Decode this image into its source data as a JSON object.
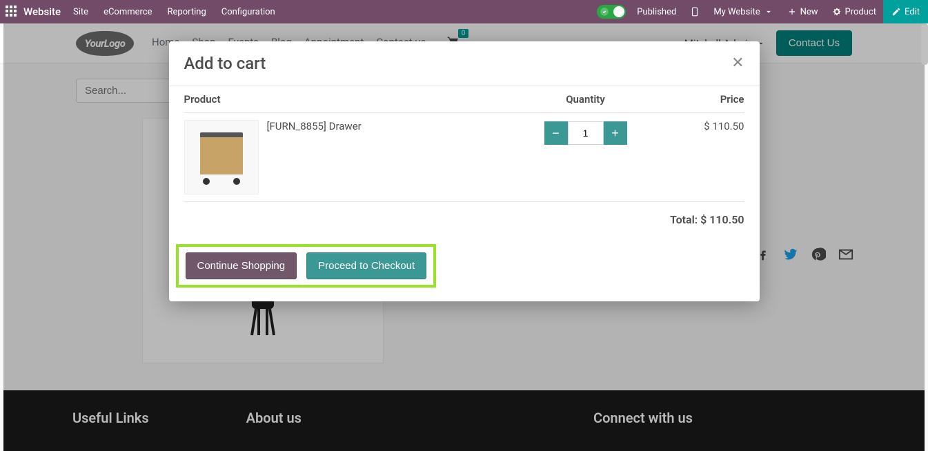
{
  "adminbar": {
    "brand": "Website",
    "menus": [
      "Site",
      "eCommerce",
      "Reporting",
      "Configuration"
    ],
    "published": "Published",
    "mywebsite": "My Website",
    "new": "New",
    "product": "Product",
    "edit": "Edit"
  },
  "site": {
    "logo": "YourLogo",
    "nav": [
      "Home",
      "Shop",
      "Events",
      "Blog",
      "Appointment",
      "Contact us"
    ],
    "cart_count": "0",
    "user": "Mitchell Admin",
    "contact": "Contact Us",
    "search_ph": "Search..."
  },
  "modal": {
    "title": "Add to cart",
    "head_product": "Product",
    "head_qty": "Quantity",
    "head_price": "Price",
    "item_name": "[FURN_8855] Drawer",
    "item_qty": "1",
    "item_price": "$ 110.50",
    "total_label": "Total: $ 110.50",
    "continue": "Continue Shopping",
    "checkout": "Proceed to Checkout"
  },
  "footer": {
    "links": "Useful Links",
    "about": "About us",
    "connect": "Connect with us"
  }
}
